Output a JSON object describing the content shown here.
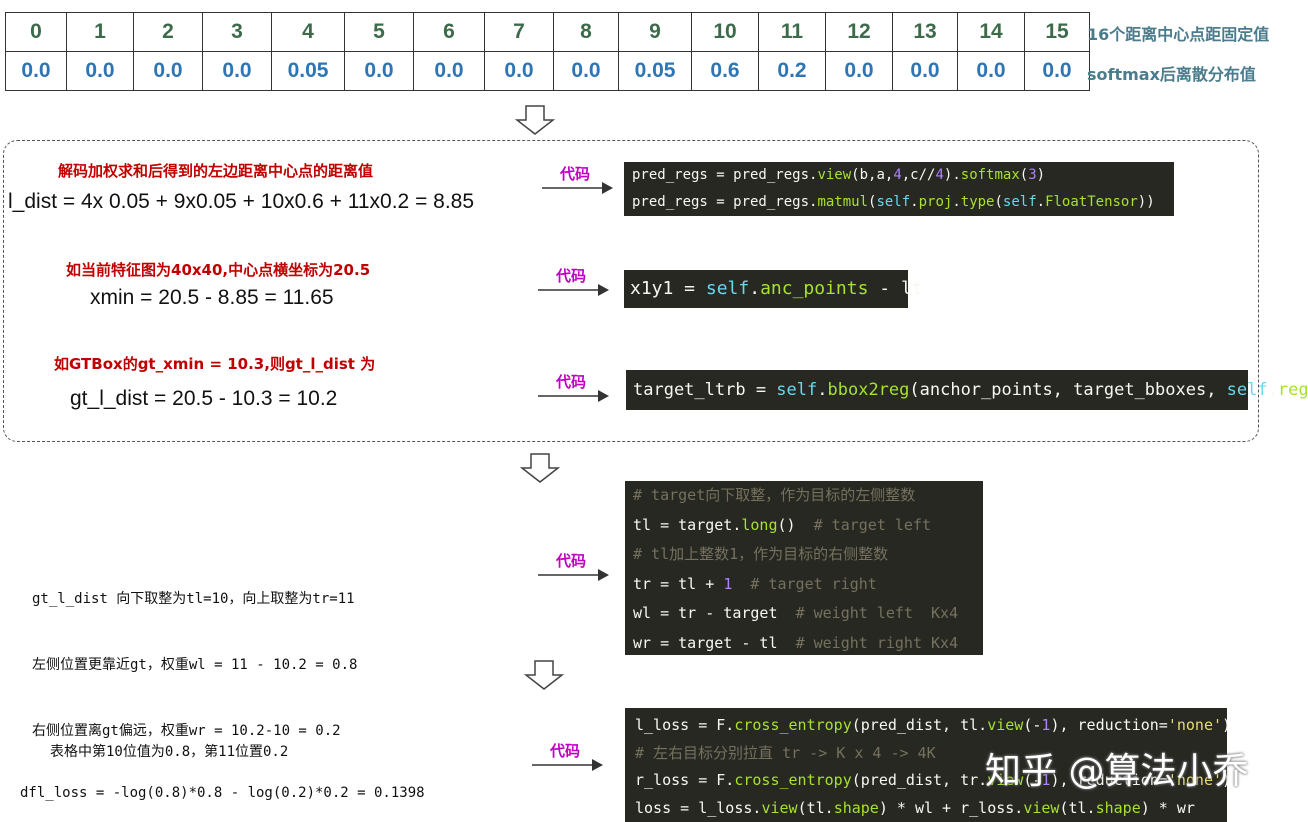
{
  "table": {
    "indices": [
      "0",
      "1",
      "2",
      "3",
      "4",
      "5",
      "6",
      "7",
      "8",
      "9",
      "10",
      "11",
      "12",
      "13",
      "14",
      "15"
    ],
    "values": [
      "0.0",
      "0.0",
      "0.0",
      "0.0",
      "0.05",
      "0.0",
      "0.0",
      "0.0",
      "0.0",
      "0.05",
      "0.6",
      "0.2",
      "0.0",
      "0.0",
      "0.0",
      "0.0"
    ],
    "row1_label": "16个距离中心点距固定值",
    "row2_label": "softmax后离散分布值"
  },
  "section1": {
    "title": "解码加权求和后得到的左边距离中心点的距离值",
    "equation": "l_dist = 4x 0.05 + 9x0.05 + 10x0.6 + 11x0.2 = 8.85",
    "code_label": "代码",
    "code": [
      [
        [
          "t",
          "pred_regs = pred_regs."
        ],
        [
          "f",
          "view"
        ],
        [
          "t",
          "(b,a,"
        ],
        [
          "n",
          "4"
        ],
        [
          "t",
          ",c//"
        ],
        [
          "n",
          "4"
        ],
        [
          "t",
          ")."
        ],
        [
          "f",
          "softmax"
        ],
        [
          "t",
          "("
        ],
        [
          "n",
          "3"
        ],
        [
          "t",
          ")"
        ]
      ],
      [
        [
          "t",
          "pred_regs = pred_regs."
        ],
        [
          "f",
          "matmul"
        ],
        [
          "t",
          "("
        ],
        [
          "s",
          "self"
        ],
        [
          "t",
          "."
        ],
        [
          "f",
          "proj"
        ],
        [
          "t",
          "."
        ],
        [
          "f",
          "type"
        ],
        [
          "t",
          "("
        ],
        [
          "s",
          "self"
        ],
        [
          "t",
          "."
        ],
        [
          "f",
          "FloatTensor"
        ],
        [
          "t",
          "))"
        ]
      ]
    ]
  },
  "section2": {
    "title": "如当前特征图为40x40,中心点横坐标为20.5",
    "equation": "xmin = 20.5 - 8.85 = 11.65",
    "code_label": "代码",
    "code": [
      [
        [
          "t",
          "x1y1 = "
        ],
        [
          "s",
          "self"
        ],
        [
          "t",
          "."
        ],
        [
          "f",
          "anc_points"
        ],
        [
          "t",
          " - lt"
        ]
      ]
    ]
  },
  "section3": {
    "title": "如GTBox的gt_xmin = 10.3,则gt_l_dist 为",
    "equation": "gt_l_dist = 20.5 - 10.3 = 10.2",
    "code_label": "代码",
    "code": [
      [
        [
          "t",
          "target_ltrb = "
        ],
        [
          "s",
          "self"
        ],
        [
          "t",
          "."
        ],
        [
          "f",
          "bbox2reg"
        ],
        [
          "t",
          "(anchor_points, target_bboxes, "
        ],
        [
          "s",
          "self"
        ],
        [
          "t",
          "."
        ],
        [
          "f",
          "reg_max"
        ],
        [
          "t",
          ")"
        ]
      ]
    ]
  },
  "section4": {
    "lines": [
      "gt_l_dist 向下取整为tl=10，向上取整为tr=11",
      "左侧位置更靠近gt，权重wl = 11 - 10.2 = 0.8",
      "右侧位置离gt偏远，权重wr = 10.2-10 = 0.2"
    ],
    "code_label": "代码",
    "code": [
      [
        [
          "c",
          "# target向下取整，作为目标的左侧整数"
        ]
      ],
      [
        [
          "t",
          "tl = target."
        ],
        [
          "f",
          "long"
        ],
        [
          "t",
          "()  "
        ],
        [
          "c",
          "# target left"
        ]
      ],
      [
        [
          "c",
          "# tl加上整数1，作为目标的右侧整数"
        ]
      ],
      [
        [
          "t",
          "tr = tl + "
        ],
        [
          "n",
          "1"
        ],
        [
          "t",
          "  "
        ],
        [
          "c",
          "# target right"
        ]
      ],
      [
        [
          "t",
          "wl = tr - target  "
        ],
        [
          "c",
          "# weight left  Kx4"
        ]
      ],
      [
        [
          "t",
          "wr = target - tl  "
        ],
        [
          "c",
          "# weight right Kx4"
        ]
      ]
    ]
  },
  "section5": {
    "line1": "表格中第10位值为0.8，第11位置0.2",
    "line2": "dfl_loss = -log(0.8)*0.8 - log(0.2)*0.2 = 0.1398",
    "code_label": "代码",
    "code": [
      [
        [
          "t",
          "l_loss = F."
        ],
        [
          "f",
          "cross_entropy"
        ],
        [
          "t",
          "(pred_dist, tl."
        ],
        [
          "f",
          "view"
        ],
        [
          "t",
          "(-"
        ],
        [
          "n",
          "1"
        ],
        [
          "t",
          "), reduction="
        ],
        [
          "q",
          "'none'"
        ],
        [
          "t",
          ")"
        ]
      ],
      [
        [
          "c",
          "# 左右目标分别拉直 tr -> K x 4 -> 4K"
        ]
      ],
      [
        [
          "t",
          "r_loss = F."
        ],
        [
          "f",
          "cross_entropy"
        ],
        [
          "t",
          "(pred_dist, tr."
        ],
        [
          "f",
          "view"
        ],
        [
          "t",
          "(-"
        ],
        [
          "n",
          "1"
        ],
        [
          "t",
          "), reduction="
        ],
        [
          "q",
          "'none'"
        ],
        [
          "t",
          ")"
        ]
      ],
      [
        [
          "t",
          "loss = l_loss."
        ],
        [
          "f",
          "view"
        ],
        [
          "t",
          "(tl."
        ],
        [
          "f",
          "shape"
        ],
        [
          "t",
          ") * wl + r_loss."
        ],
        [
          "f",
          "view"
        ],
        [
          "t",
          "(tl."
        ],
        [
          "f",
          "shape"
        ],
        [
          "t",
          ") * wr"
        ]
      ]
    ]
  },
  "watermark": "知乎 @算法小乔"
}
